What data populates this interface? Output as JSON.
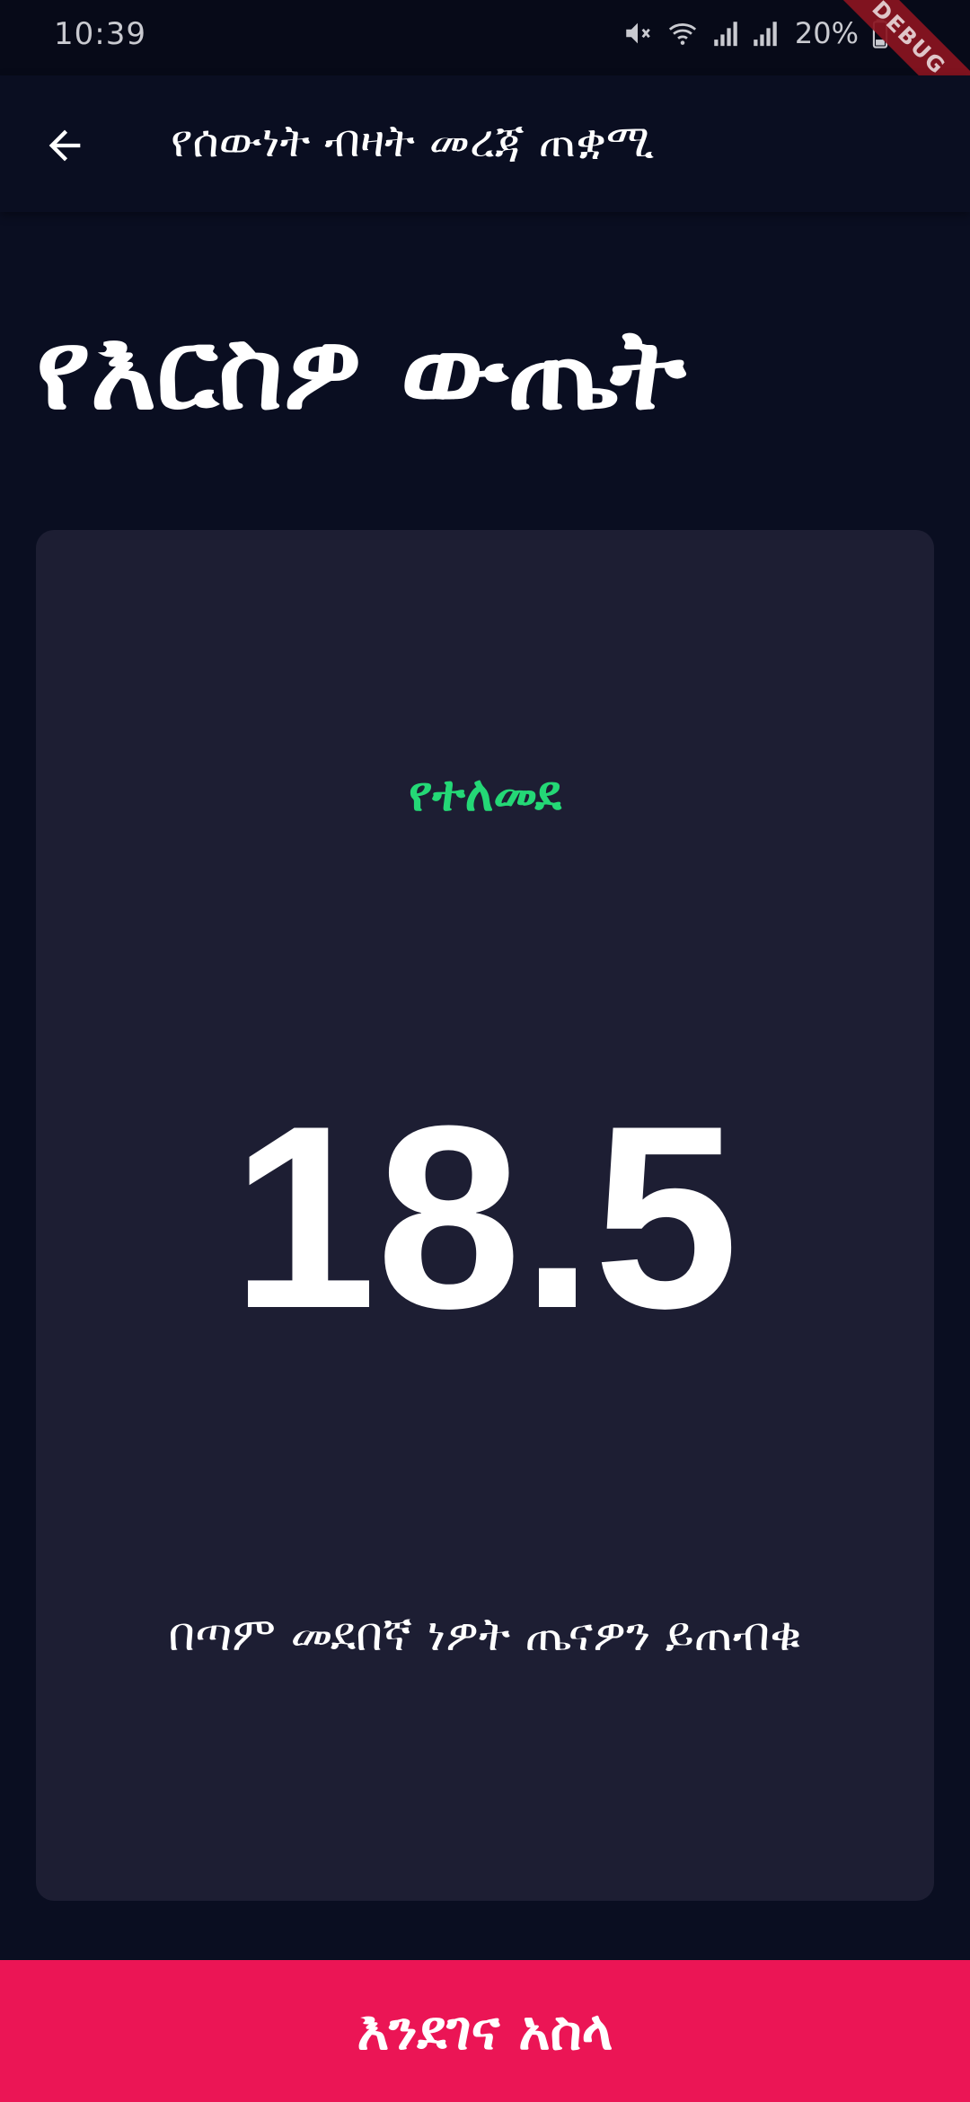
{
  "status_bar": {
    "time": "10:39",
    "battery": "20%",
    "icons": [
      "mute-icon",
      "wifi-icon",
      "signal-icon",
      "signal-icon",
      "battery-icon"
    ]
  },
  "debug_banner": "DEBUG",
  "app_bar": {
    "title": "የሰውነት ብዛት መረጃ ጠቋሚ",
    "back_icon": "arrow-left-icon"
  },
  "heading": "የእርስዎ ውጤት",
  "result": {
    "status": "የተለመደ",
    "bmi": "18.5",
    "interpretation": "በጣም መደበኛ ነዎት ጤናዎን ይጠብቁ"
  },
  "bottom_button": {
    "label": "እንደገና አስላ"
  },
  "colors": {
    "background": "#0a0e21",
    "card": "#1d1e33",
    "status_green": "#24d876",
    "accent_pink": "#eb1555"
  }
}
